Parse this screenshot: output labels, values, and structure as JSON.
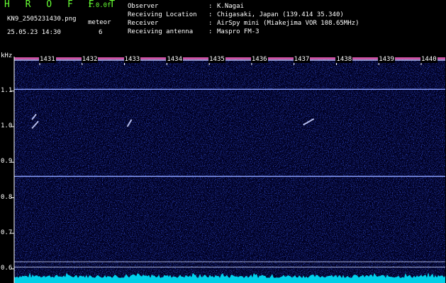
{
  "header": {
    "app_title": "H R O F F T",
    "app_version": "1.0.0f",
    "file_name": "KN9_2505231430.png",
    "timestamp": "25.05.23 14:30",
    "mode_label": "meteor",
    "mode_value": "6",
    "info": [
      {
        "key": "Observer",
        "value": "K.Nagai"
      },
      {
        "key": "Receiving Location",
        "value": "Chigasaki, Japan (139.414 35.340)"
      },
      {
        "key": "Receiver",
        "value": "AirSpy mini (Miakejima VOR 108.65MHz)"
      },
      {
        "key": "Receiving antenna",
        "value": "Maspro FM-3"
      }
    ]
  },
  "chart_data": {
    "type": "heatmap",
    "ylabel": "kHz",
    "y_ticks": [
      "1.1",
      "1.0",
      "0.9",
      "0.8",
      "0.7",
      "0.6"
    ],
    "y_tick_values": [
      1.1,
      1.0,
      0.9,
      0.8,
      0.7,
      0.6
    ],
    "ylim": [
      0.58,
      1.19
    ],
    "x_ticks": [
      "1431",
      "1432",
      "1433",
      "1434",
      "1435",
      "1436",
      "1437",
      "1438",
      "1439",
      "1440"
    ],
    "x_tick_values": [
      1431,
      1432,
      1433,
      1434,
      1435,
      1436,
      1437,
      1438,
      1439,
      1440
    ],
    "xlim": [
      1430.6,
      1440.2
    ],
    "horizontal_lines_khz": [
      1.105,
      0.86,
      0.62,
      0.605
    ],
    "meteor_traces": [
      {
        "x": [
          1430.65,
          1430.8
        ],
        "y": [
          0.995,
          1.015
        ]
      },
      {
        "x": [
          1430.65,
          1430.75
        ],
        "y": [
          1.02,
          1.035
        ]
      },
      {
        "x": [
          1432.9,
          1433.0
        ],
        "y": [
          1.0,
          1.02
        ]
      },
      {
        "x": [
          1437.05,
          1437.3
        ],
        "y": [
          1.005,
          1.022
        ]
      }
    ],
    "colors": {
      "background": "#00001a",
      "noise": "#1a2cff",
      "line": "#8aa0ff",
      "bottom_trace": "#00e5ff",
      "top_band": "#ff66cc"
    }
  }
}
